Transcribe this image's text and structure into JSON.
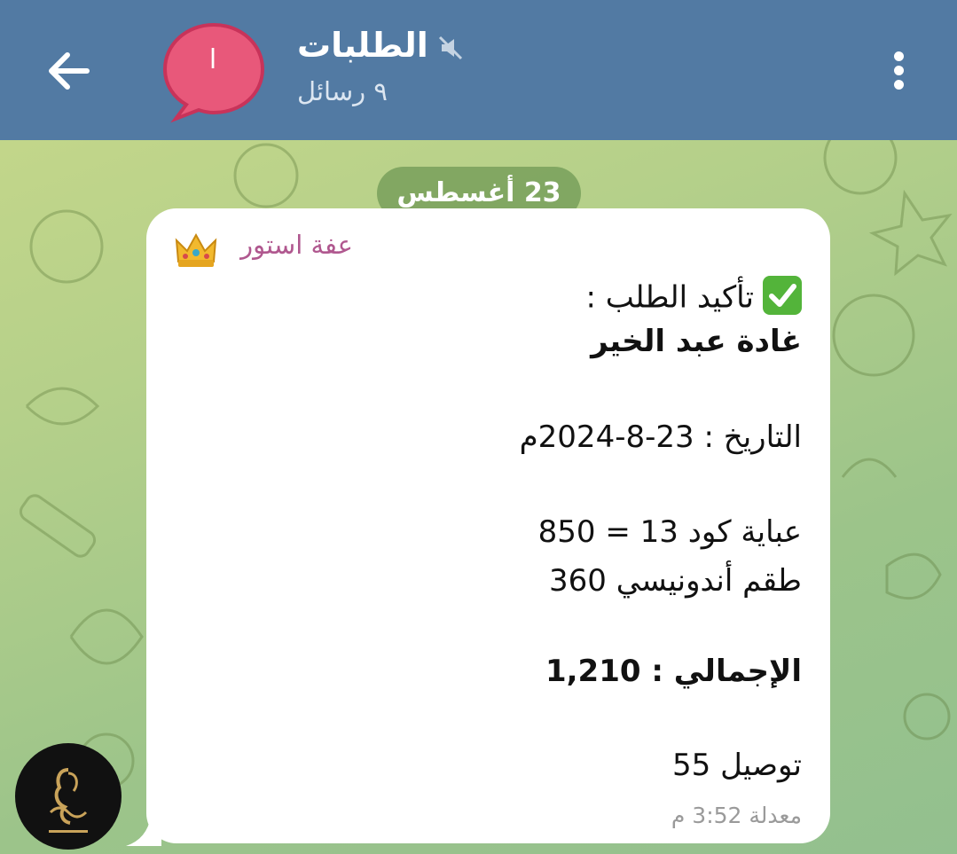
{
  "header": {
    "back_icon": "arrow-left-icon",
    "avatar_letter": "ا",
    "title": "الطلبات",
    "mute_icon": "muted-speaker-icon",
    "subtitle": "٩ رسائل",
    "menu_icon": "more-vertical-icon"
  },
  "chat": {
    "date_label": "23 أغسطس",
    "message": {
      "sender": "عفة استور",
      "sender_icon": "crown-emoji",
      "line1": "تأكيد الطلب :",
      "line1_icon": "check-mark-emoji",
      "customer_name": "غادة عبد الخير",
      "date_line": "التاريخ : 23-8-2024م",
      "item1": "عباية  كود 13 = 850",
      "item2": "طقم أندونيسي 360",
      "total_line": "الإجمالي : 1,210",
      "delivery_line": "توصيل 55",
      "edited_label": "معدلة",
      "time": "3:52 م"
    }
  },
  "colors": {
    "header_bg": "#527aa3",
    "avatar_bg": "#e8587a",
    "sender_color": "#b0588f",
    "date_pill_bg": "#7aa05a"
  }
}
